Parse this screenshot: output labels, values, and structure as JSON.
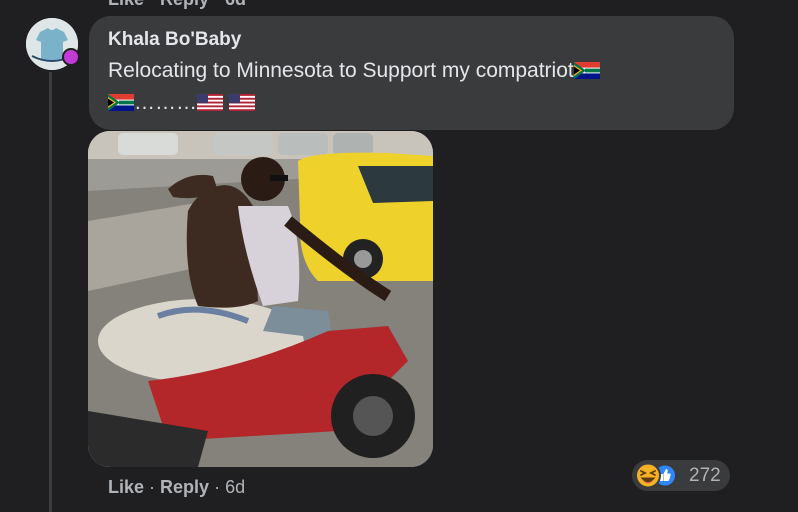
{
  "previous_comment": {
    "actions_partial": "Like · Reply · 6d"
  },
  "comment": {
    "author": "Khala Bo'Baby",
    "text_line1": "Relocating to Minnesota to Support my compatriot",
    "text_line2_dots": "………",
    "flags": [
      "south-africa-flag",
      "south-africa-flag",
      "us-flag",
      "us-flag"
    ]
  },
  "actions": {
    "like": "Like",
    "sep": " · ",
    "reply": "Reply",
    "time": "6d"
  },
  "reactions": {
    "icons": [
      "laughing-emoji-icon",
      "thumbs-up-icon"
    ],
    "count": "272"
  },
  "colors": {
    "background": "#1f1f21",
    "bubble": "#3a3b3c",
    "text": "#e4e6eb",
    "secondary_text": "#b0b3b8",
    "like_blue": "#2d88ff",
    "haha_yellow": "#f7b125"
  }
}
